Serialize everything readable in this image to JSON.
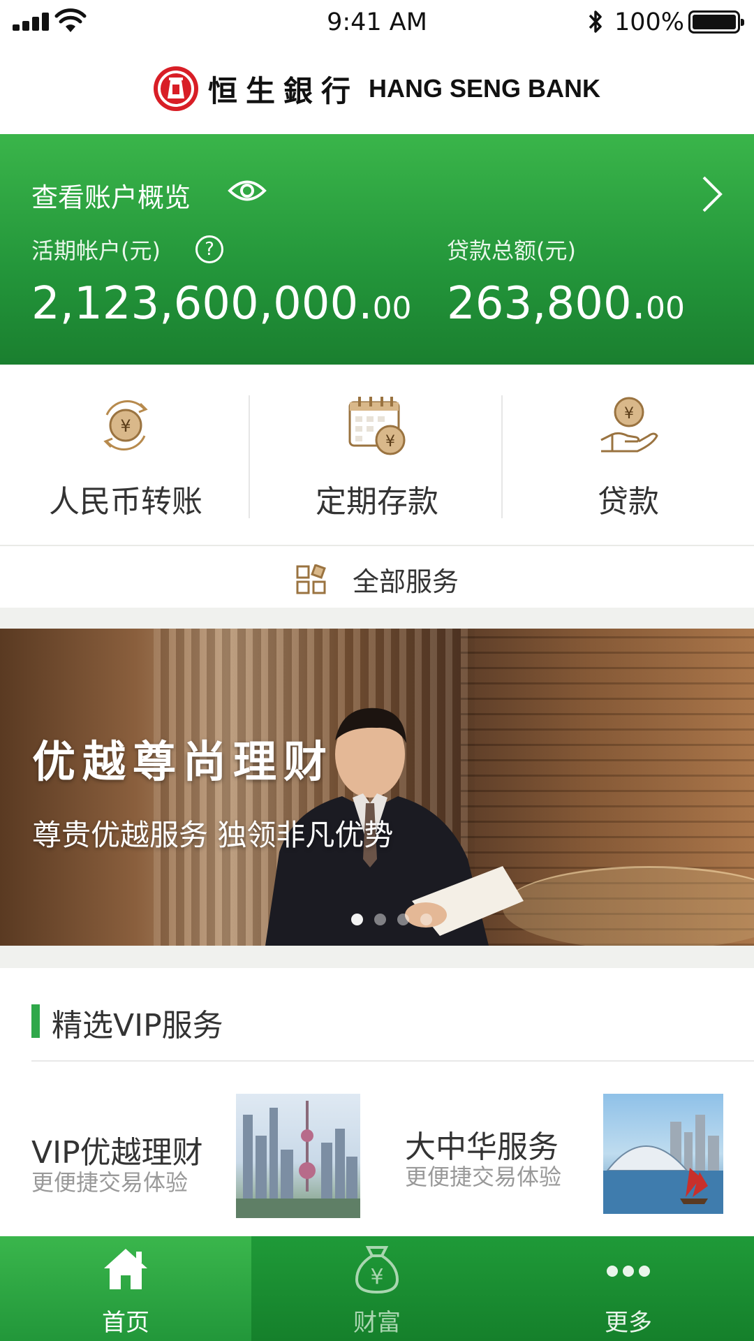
{
  "status_bar": {
    "time": "9:41 AM",
    "battery": "100%"
  },
  "header": {
    "logo_cn": "恒生銀行",
    "logo_en": "HANG SENG BANK"
  },
  "summary": {
    "title": "查看账户概览",
    "current_account": {
      "label": "活期帐户(元)",
      "amount": "2,123,600,000.",
      "cents": "00"
    },
    "loan_total": {
      "label": "贷款总额(元)",
      "amount": "263,800.",
      "cents": "00"
    }
  },
  "quick_actions": [
    {
      "label": "人民币转账",
      "icon": "rmb-transfer-icon"
    },
    {
      "label": "定期存款",
      "icon": "fixed-deposit-icon"
    },
    {
      "label": "贷款",
      "icon": "loan-icon"
    }
  ],
  "all_services": {
    "label": "全部服务",
    "icon": "grid-icon"
  },
  "banner": {
    "title": "优越尊尚理财",
    "subtitle": "尊贵优越服务 独领非凡优势",
    "slide_count": 4,
    "active_slide": 1
  },
  "vip_section": {
    "title": "精选VIP服务",
    "cards": [
      {
        "title": "VIP优越理财",
        "subtitle": "更便捷交易体验"
      },
      {
        "title": "大中华服务",
        "subtitle": "更便捷交易体验"
      }
    ]
  },
  "tab_bar": [
    {
      "label": "首页",
      "icon": "home-icon",
      "active": true
    },
    {
      "label": "财富",
      "icon": "money-bag-icon",
      "active": false
    },
    {
      "label": "更多",
      "icon": "more-dots-icon",
      "active": false
    }
  ],
  "colors": {
    "brand_green": "#2fa84a",
    "brand_red": "#d81e26",
    "accent_gold": "#b78a4d"
  }
}
